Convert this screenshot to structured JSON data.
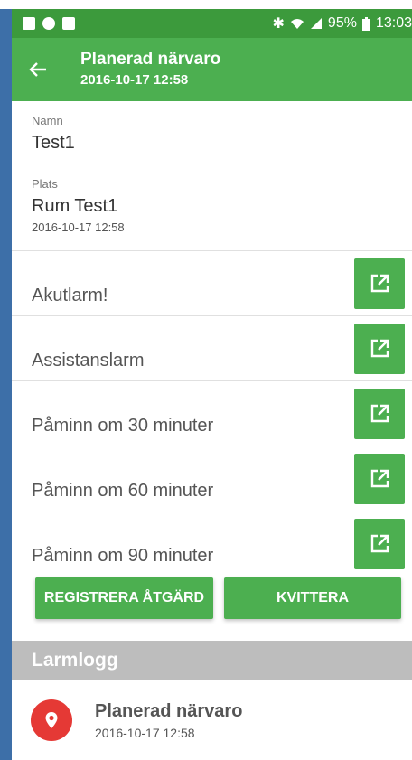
{
  "status": {
    "battery": "95%",
    "time": "13:03"
  },
  "appbar": {
    "title": "Planerad närvaro",
    "subtitle": "2016-10-17 12:58"
  },
  "details": {
    "name_label": "Namn",
    "name_value": "Test1",
    "place_label": "Plats",
    "place_value": "Rum Test1",
    "place_date": "2016-10-17 12:58"
  },
  "alarms": [
    {
      "label": "Akutlarm!"
    },
    {
      "label": "Assistanslarm"
    },
    {
      "label": "Påminn om 30 minuter"
    },
    {
      "label": "Påminn om 60 minuter"
    },
    {
      "label": "Påminn om 90 minuter"
    }
  ],
  "actions": {
    "register": "REGISTRERA ÅTGÄRD",
    "acknowledge": "KVITTERA"
  },
  "log": {
    "header": "Larmlogg",
    "items": [
      {
        "title": "Planerad närvaro",
        "date": "2016-10-17 12:58"
      }
    ]
  },
  "colors": {
    "primary": "#4caf50",
    "primary_dark": "#3c9a3c",
    "alert": "#e53935",
    "log_header": "#bdbdbd"
  }
}
